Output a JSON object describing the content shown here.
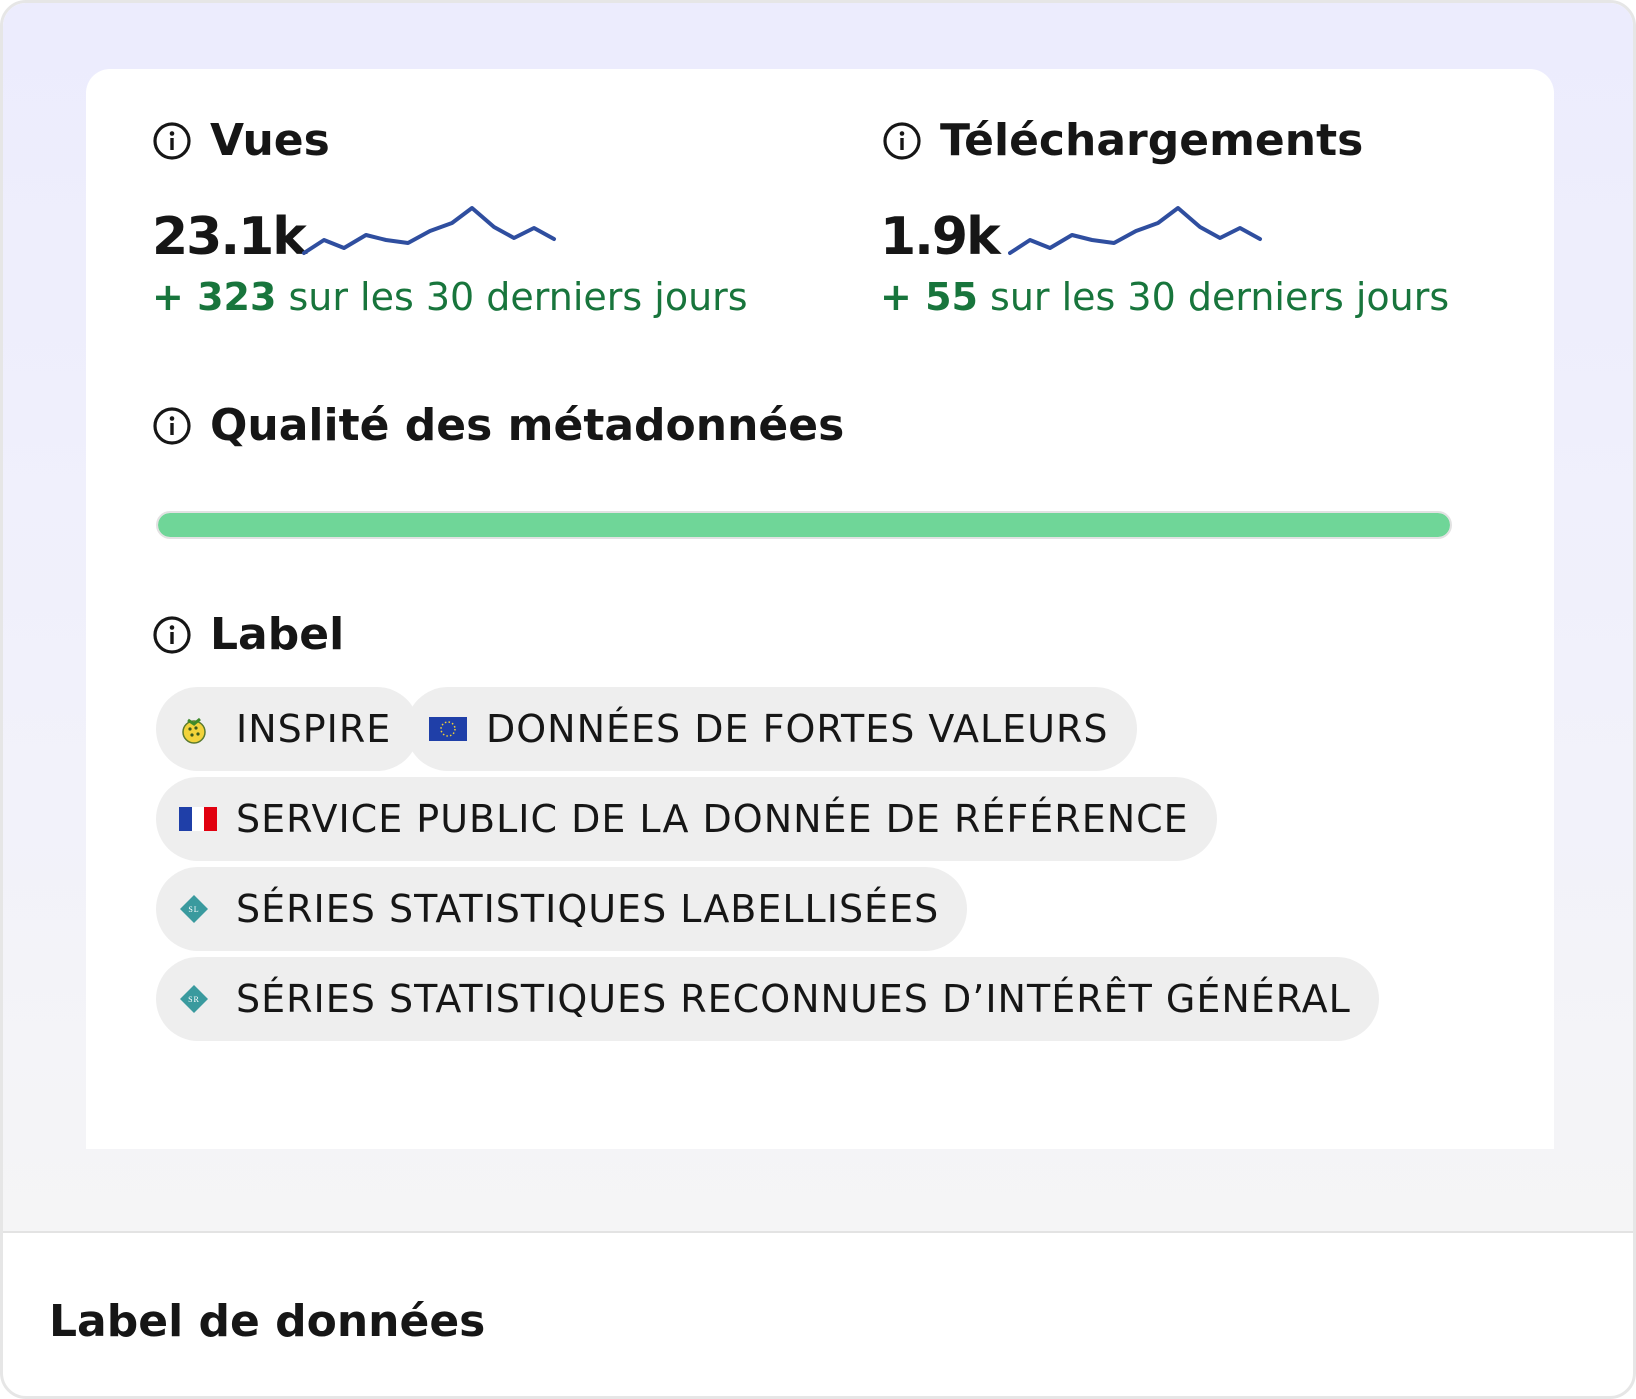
{
  "stats": {
    "views": {
      "title": "Vues",
      "value": "23.1k",
      "delta_prefix": "+ 323",
      "delta_suffix": " sur les 30 derniers jours"
    },
    "downloads": {
      "title": "Téléchargements",
      "value": "1.9k",
      "delta_prefix": "+ 55",
      "delta_suffix": " sur les 30 derniers jours"
    }
  },
  "quality": {
    "title": "Qualité des métadonnées",
    "fill_fraction": 1.0,
    "fill_color": "#6fd698"
  },
  "labels": {
    "title": "Label",
    "badges": [
      {
        "text": "INSPIRE",
        "icon": "inspire-logo-icon"
      },
      {
        "text": "DONNÉES DE FORTES VALEURS",
        "icon": "eu-flag-icon"
      },
      {
        "text": "SERVICE PUBLIC DE LA DONNÉE DE RÉFÉRENCE",
        "icon": "french-flag-icon"
      },
      {
        "text": "SÉRIES STATISTIQUES LABELLISÉES",
        "icon": "sl-diamond-icon"
      },
      {
        "text": "SÉRIES STATISTIQUES RECONNUES D’INTÉRÊT GÉNÉRAL",
        "icon": "sr-diamond-icon"
      }
    ]
  },
  "footer": {
    "title": "Label de données"
  },
  "colors": {
    "accent_green": "#18753c",
    "sparkline": "#2f4e9f",
    "hero_background": "#ececfd",
    "badge_background": "#eeeeee"
  }
}
